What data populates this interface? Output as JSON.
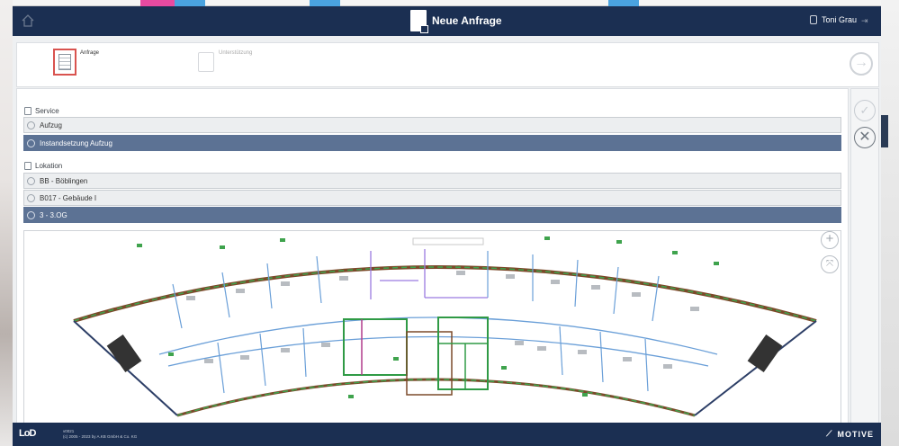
{
  "header": {
    "title": "Neue Anfrage",
    "user": "Toni Grau"
  },
  "steps": [
    {
      "label": "Anfrage"
    },
    {
      "label": "Unterstützung"
    }
  ],
  "service": {
    "heading": "Service",
    "items": [
      {
        "label": "Aufzug",
        "selected": false
      },
      {
        "label": "Instandsetzung Aufzug",
        "selected": true
      }
    ]
  },
  "location": {
    "heading": "Lokation",
    "items": [
      {
        "label": "BB - Böblingen",
        "selected": false
      },
      {
        "label": "B017 - Gebäude I",
        "selected": false
      },
      {
        "label": "3 - 3.OG",
        "selected": true
      }
    ]
  },
  "footer": {
    "logo": "LoD",
    "copyright_line1": "v0021",
    "copyright_line2": "(c) 2005 - 2023 by A.KB GmbH & Co. KG",
    "brand": "MOTIVE"
  },
  "colors": {
    "header_bg": "#1b2f52",
    "selected_row": "#5c7294",
    "step_highlight": "#d9534f"
  },
  "icons": {
    "home": "home-icon",
    "user": "user-icon",
    "logout": "logout-icon",
    "next": "arrow-right-circle-icon",
    "confirm": "check-circle-icon",
    "cancel": "x-circle-icon",
    "zoom_in": "plus-circle-icon",
    "fit": "fit-to-screen-icon"
  }
}
